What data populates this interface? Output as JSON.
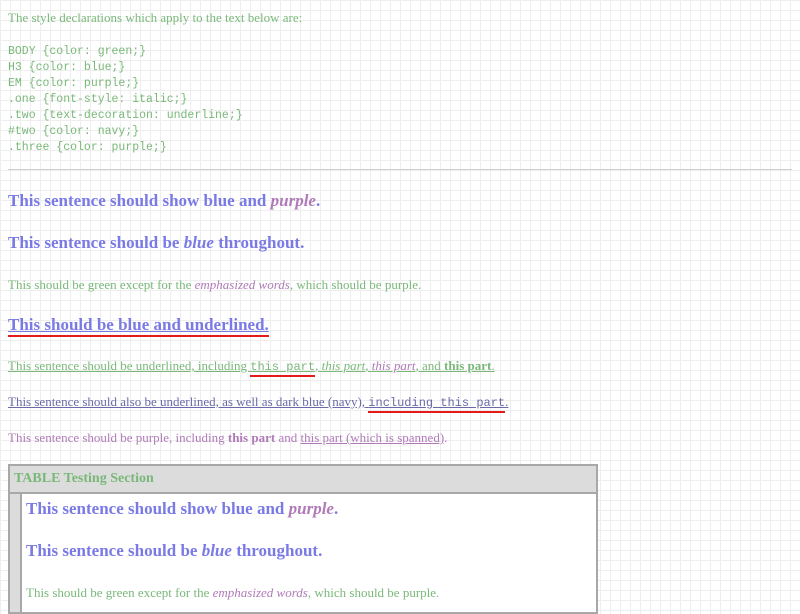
{
  "intro": "The style declarations which apply to the text below are:",
  "declarations": [
    "BODY {color: green;}",
    "H3 {color: blue;}",
    "EM {color: purple;}",
    ".one {font-style: italic;}",
    ".two {text-decoration: underline;}",
    "#two {color: navy;}",
    ".three {color: purple;}"
  ],
  "test1": {
    "before": "This sentence should show blue and ",
    "em": "purple",
    "after": "."
  },
  "test2": {
    "before": "This sentence should be ",
    "em": "blue",
    "after": " throughout."
  },
  "test3": {
    "before": "This should be green except for the ",
    "em": "emphasized words",
    "after": ", which should be purple."
  },
  "test4": {
    "text": "This should be blue and underlined."
  },
  "test5": {
    "before": "This sentence should be underlined, including ",
    "code": "this part",
    "sep1": ", ",
    "italic1": "this part",
    "sep2": ", ",
    "italic2": "this part",
    "sep3": ", and ",
    "bold": "this part",
    "after": "."
  },
  "test6": {
    "before": "This sentence should also be underlined, as well as dark blue (navy), ",
    "code": "including this part",
    "after": "."
  },
  "test7": {
    "before": "This sentence should be purple, including ",
    "bold": "this part",
    "mid": " and ",
    "span": "this part (which is spanned)",
    "after": "."
  },
  "table": {
    "caption": "TABLE Testing Section",
    "test1": {
      "before": "This sentence should show blue and ",
      "em": "purple",
      "after": "."
    },
    "test2": {
      "before": "This sentence should be ",
      "em": "blue",
      "after": " throughout."
    },
    "test3": {
      "before": "This should be green except for the ",
      "em": "emphasized words",
      "after": ", which should be purple."
    }
  },
  "colors": {
    "green": "#7ab87a",
    "blue": "#7a7ae6",
    "purple": "#b07ab8",
    "navy": "#6a6aa8",
    "red_marker": "#e31b1b"
  }
}
